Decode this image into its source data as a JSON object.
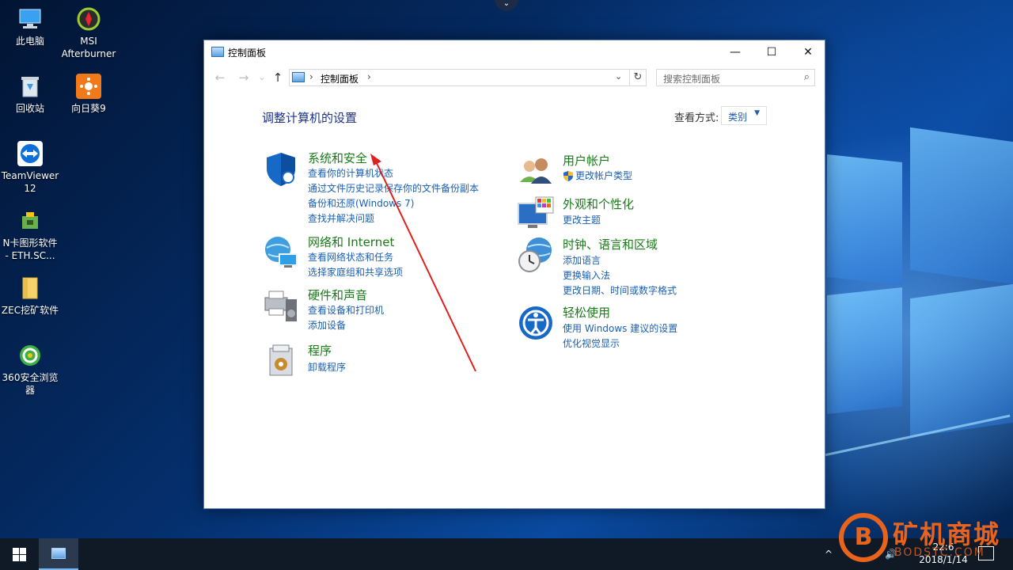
{
  "desktop": {
    "icons": [
      {
        "label": "此电脑",
        "icon": "computer-icon"
      },
      {
        "label": "MSI\nAfterburner",
        "icon": "msi-afterburner-icon"
      },
      {
        "label": "回收站",
        "icon": "recycle-bin-icon"
      },
      {
        "label": "向日葵9",
        "icon": "sunflower-icon"
      },
      {
        "label": "TeamViewer\n12",
        "icon": "teamviewer-icon"
      },
      {
        "label": "N卡图形软件\n- ETH.SC...",
        "icon": "nvidia-tool-icon"
      },
      {
        "label": "ZEC挖矿软件",
        "icon": "folder-icon"
      },
      {
        "label": "360安全浏览\n器",
        "icon": "360-browser-icon"
      }
    ]
  },
  "window": {
    "title": "控制面板",
    "controls": {
      "minimize": "—",
      "maximize": "☐",
      "close": "✕"
    },
    "nav": {
      "back": "←",
      "forward": "→",
      "recent": "⌄",
      "up": "↑"
    },
    "address": {
      "crumb": "控制面板",
      "separator": "›",
      "dropdown": "⌄"
    },
    "refresh": "↻",
    "search": {
      "placeholder": "搜索控制面板",
      "icon": "search-icon"
    }
  },
  "main": {
    "heading": "调整计算机的设置",
    "view_by_label": "查看方式:",
    "view_by_value": "类别",
    "view_by_caret": "▼",
    "categories_left": [
      {
        "title": "系统和安全",
        "icon": "shield-icon",
        "links": [
          "查看你的计算机状态",
          "通过文件历史记录保存你的文件备份副本",
          "备份和还原(Windows 7)",
          "查找并解决问题"
        ]
      },
      {
        "title": "网络和 Internet",
        "icon": "network-globe-icon",
        "links": [
          "查看网络状态和任务",
          "选择家庭组和共享选项"
        ]
      },
      {
        "title": "硬件和声音",
        "icon": "printer-speaker-icon",
        "links": [
          "查看设备和打印机",
          "添加设备"
        ]
      },
      {
        "title": "程序",
        "icon": "programs-icon",
        "links": [
          "卸载程序"
        ]
      }
    ],
    "categories_right": [
      {
        "title": "用户帐户",
        "icon": "users-icon",
        "links": [
          "更改帐户类型"
        ]
      },
      {
        "title": "外观和个性化",
        "icon": "monitor-palette-icon",
        "links": [
          "更改主题"
        ]
      },
      {
        "title": "时钟、语言和区域",
        "icon": "clock-globe-icon",
        "links": [
          "添加语言",
          "更换输入法",
          "更改日期、时间或数字格式"
        ]
      },
      {
        "title": "轻松使用",
        "icon": "accessibility-icon",
        "links": [
          "使用 Windows 建议的设置",
          "优化视觉显示"
        ]
      }
    ]
  },
  "taskbar": {
    "tray_chevron": "^",
    "clock_time": "22:6",
    "clock_date": "2018/1/14"
  },
  "watermark": {
    "logo_letter": "B",
    "brand": "矿机商城",
    "site": "BODSTC.COM"
  },
  "colors": {
    "category_title": "#1a7a1a",
    "link": "#1a5fb4",
    "heading": "#1e3287",
    "annotation_arrow": "#e0201e",
    "watermark": "#e8631c"
  }
}
